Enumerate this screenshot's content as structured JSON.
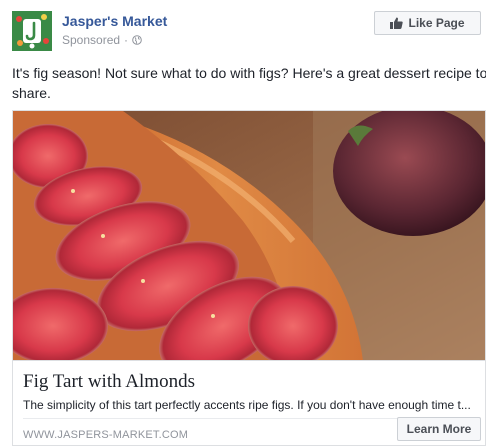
{
  "header": {
    "page_name": "Jasper's Market",
    "sponsored": "Sponsored",
    "separator": "·",
    "like_button": "Like Page"
  },
  "post": {
    "text": "It's fig season! Not sure what to do with figs? Here's a great dessert recipe to share."
  },
  "link_card": {
    "title": "Fig Tart with Almonds",
    "description": "The simplicity of this tart perfectly accents ripe figs. If you don't have enough time t...",
    "domain": "WWW.JASPERS-MARKET.COM",
    "cta": "Learn More"
  },
  "colors": {
    "link_blue": "#365899",
    "meta_gray": "#90949c",
    "button_bg": "#f6f7f9",
    "border": "#dddfe2"
  },
  "icons": {
    "avatar": "jaspers-market-logo",
    "like": "thumbs-up-icon",
    "audience": "globe-icon"
  }
}
